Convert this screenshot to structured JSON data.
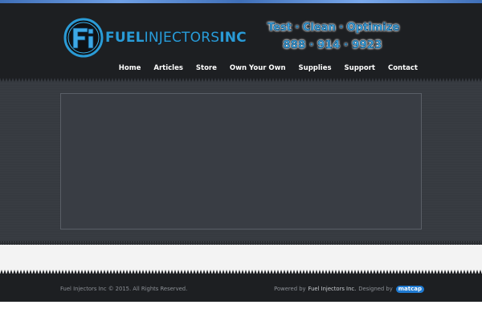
{
  "site": {
    "logo": {
      "word_part1": "FUEL",
      "word_part2": "INJECTORS",
      "word_part3": "INC",
      "mark_letter": "Fi"
    },
    "promo": {
      "tagline": "Test · Clean · Optimize",
      "phone": "888 · 914 · 9923"
    }
  },
  "nav": {
    "items": [
      {
        "label": "Home"
      },
      {
        "label": "Articles"
      },
      {
        "label": "Store"
      },
      {
        "label": "Own Your Own"
      },
      {
        "label": "Supplies"
      },
      {
        "label": "Support"
      },
      {
        "label": "Contact"
      }
    ]
  },
  "footer": {
    "copyright": "Fuel Injectors Inc © 2015. All Rights Reserved.",
    "powered_prefix": "Powered by",
    "powered_link": "Fuel Injectors Inc.",
    "designed_prefix": "Designed by",
    "designer": "matcap"
  },
  "colors": {
    "brand_blue": "#2a9bd6",
    "header_bg": "#1d1f22",
    "content_bg": "#363a40",
    "light_band": "#f3f3f3",
    "designer_badge": "#1f7ad1"
  }
}
